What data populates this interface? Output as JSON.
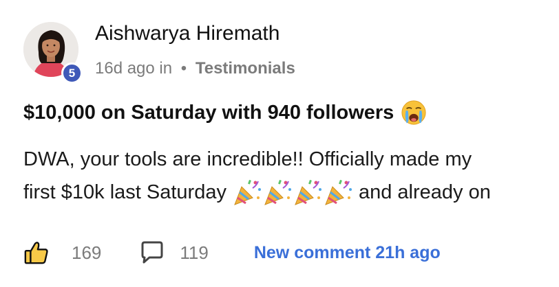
{
  "post": {
    "author_name": "Aishwarya Hiremath",
    "level": "5",
    "time_ago": "16d ago in",
    "separator": "•",
    "category": "Testimonials",
    "title": "$10,000 on Saturday with 940 followers",
    "title_emoji": "crying-face-icon",
    "body_line1": "DWA, your tools are incredible!! Officially made my",
    "body_line2_start": "first $10k last Saturday",
    "body_line2_end": "and already on",
    "party_emoji": "party-popper-icon",
    "party_emoji_count": 4
  },
  "footer": {
    "like_count": "169",
    "comment_count": "119",
    "new_comment_label": "New comment 21h ago"
  },
  "colors": {
    "level_badge": "#3f59b8",
    "link_blue": "#3a6fd8",
    "muted_gray": "#7b7b7b",
    "like_yellow": "#f7c948"
  }
}
